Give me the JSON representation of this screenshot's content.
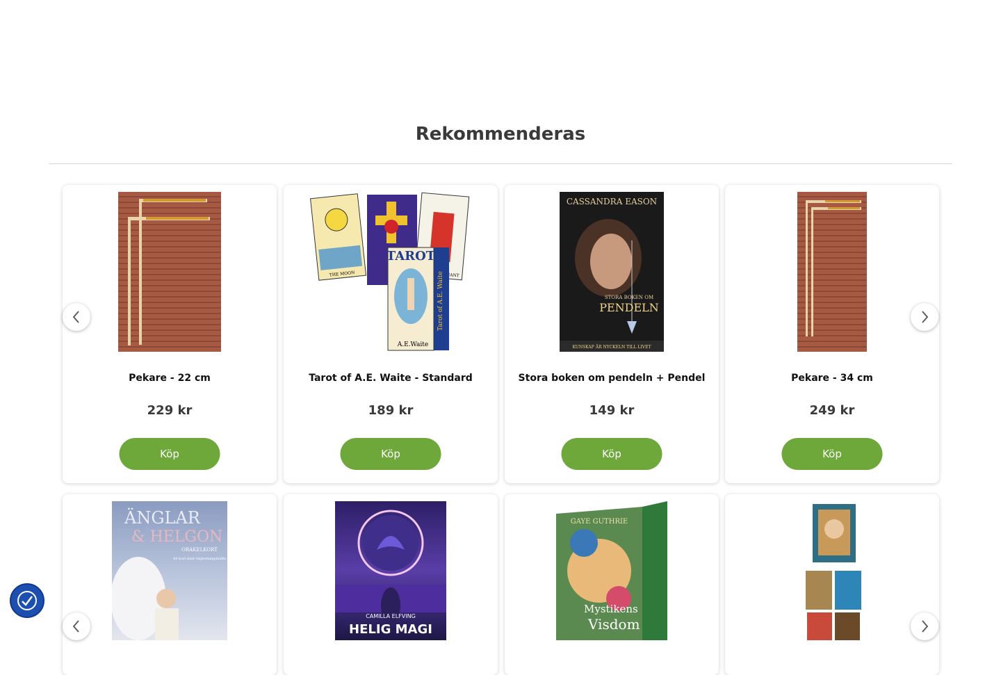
{
  "section": {
    "title": "Rekommenderas"
  },
  "carousel": {
    "prev_label": "‹",
    "next_label": "›"
  },
  "products_row1": [
    {
      "name": "Pekare - 22 cm",
      "price": "229 kr",
      "buy": "Köp"
    },
    {
      "name": "Tarot of A.E. Waite - Standard",
      "price": "189 kr",
      "buy": "Köp"
    },
    {
      "name": "Stora boken om pendeln + Pendel",
      "price": "149 kr",
      "buy": "Köp"
    },
    {
      "name": "Pekare - 34 cm",
      "price": "249 kr",
      "buy": "Köp"
    }
  ],
  "covers": {
    "tarot": {
      "brand": "TAROT",
      "side": "Tarot of A.E. Waite",
      "waite": "A.E.Waite",
      "moon": "THE MOON",
      "hiero": "THE HIEROPHANT"
    },
    "pendeln": {
      "author": "CASSANDRA EASON",
      "subtitle": "STORA BOKEN OM",
      "title": "PENDELN",
      "band": "KUNSKAP ÄR NYCKELN TILL LIVET"
    },
    "anglar": {
      "title": "ÄNGLAR",
      "amp": "& HELGON",
      "sub": "ORAKELKORT",
      "desc": "44 kort med vägledningshäfte"
    },
    "helig": {
      "author": "CAMILLA ELFVING",
      "title": "HELIG MAGI"
    },
    "mystik": {
      "author": "GAYE GUTHRIE",
      "title": "Mystikens",
      "title2": "Visdom"
    }
  },
  "colors": {
    "buy_button": "#6fa83a",
    "accessibility": "#1c4fb0"
  },
  "icons": {
    "prev": "chevron-left-icon",
    "next": "chevron-right-icon",
    "accessibility": "accessibility-icon"
  }
}
